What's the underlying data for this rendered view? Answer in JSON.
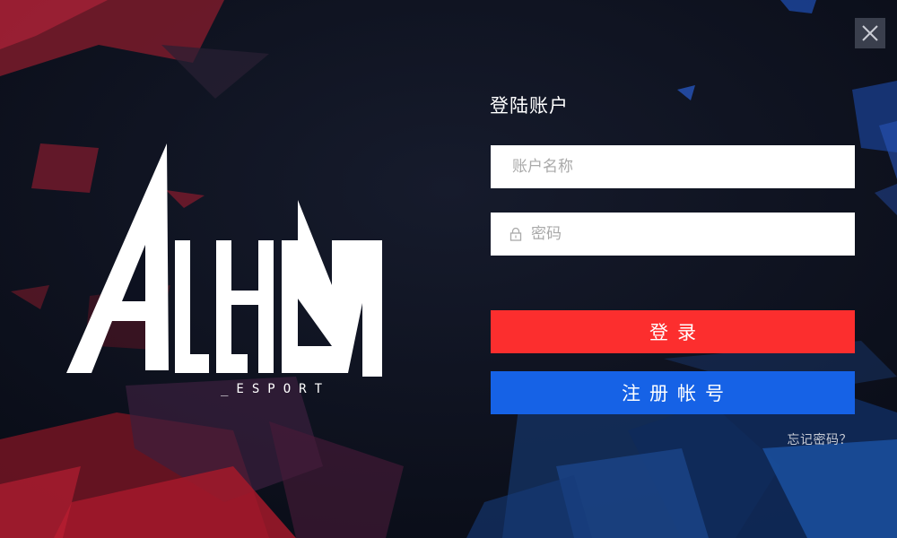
{
  "window": {
    "close_label": "close"
  },
  "logo": {
    "text": "ALL-IN",
    "subtitle": "_ESPORT"
  },
  "login": {
    "title": "登陆账户",
    "username_placeholder": "账户名称",
    "password_placeholder": "密码",
    "login_button": "登录",
    "register_button": "注册帐号",
    "forgot_password": "忘记密码？"
  },
  "colors": {
    "background": "#0b0f1c",
    "login_button": "#fc2e2e",
    "register_button": "#1662e6",
    "close_button": "#3a3f4d"
  },
  "icons": {
    "close": "close-icon",
    "lock": "lock-icon"
  }
}
